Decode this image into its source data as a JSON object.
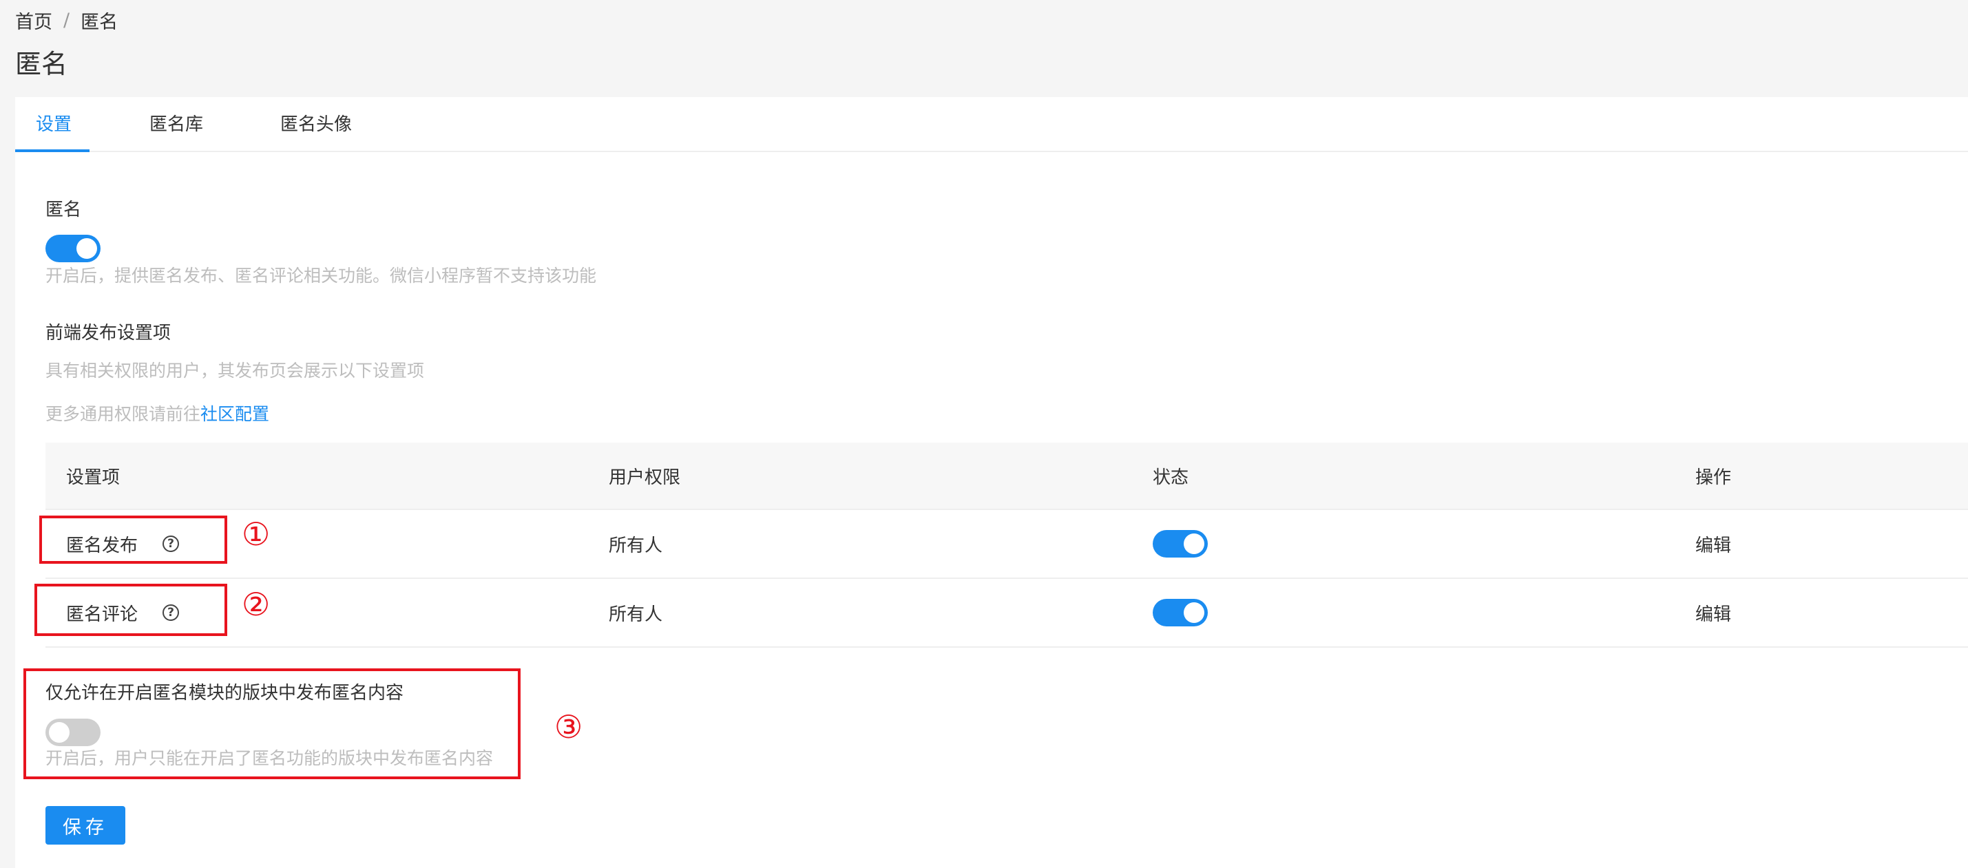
{
  "breadcrumb": {
    "home": "首页",
    "separator": "/",
    "current": "匿名"
  },
  "page_title": "匿名",
  "tabs": [
    {
      "label": "设置",
      "active": true
    },
    {
      "label": "匿名库",
      "active": false
    },
    {
      "label": "匿名头像",
      "active": false
    }
  ],
  "anonymous": {
    "label": "匿名",
    "enabled": true,
    "hint": "开启后，提供匿名发布、匿名评论相关功能。微信小程序暂不支持该功能"
  },
  "frontend": {
    "label": "前端发布设置项",
    "hint1": "具有相关权限的用户，其发布页会展示以下设置项",
    "hint2_prefix": "更多通用权限请前往",
    "hint2_link": "社区配置"
  },
  "table": {
    "headers": {
      "item": "设置项",
      "permission": "用户权限",
      "status": "状态",
      "action": "操作"
    },
    "rows": [
      {
        "item": "匿名发布",
        "permission": "所有人",
        "enabled": true,
        "action": "编辑",
        "marker": "①"
      },
      {
        "item": "匿名评论",
        "permission": "所有人",
        "enabled": true,
        "action": "编辑",
        "marker": "②"
      }
    ]
  },
  "module_only": {
    "label": "仅允许在开启匿名模块的版块中发布匿名内容",
    "enabled": false,
    "hint": "开启后，用户只能在开启了匿名功能的版块中发布匿名内容",
    "marker": "③"
  },
  "save_label": "保存",
  "colors": {
    "accent": "#1a8cf0",
    "annotation": "#e8141e",
    "toggle_off": "#cfcfcf"
  },
  "icons": {
    "help": "question-circle-icon"
  }
}
